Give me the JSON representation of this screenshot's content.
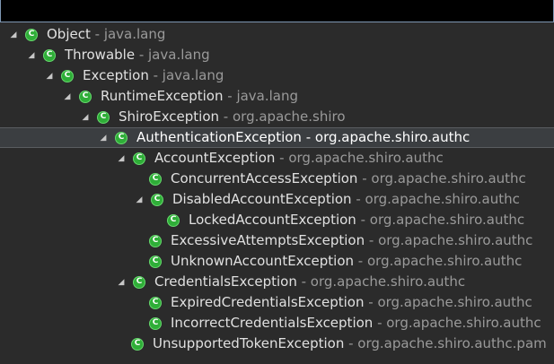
{
  "hierarchy": {
    "separator": " - ",
    "nodes": [
      {
        "name": "Object",
        "package": "java.lang",
        "expanded": true
      },
      {
        "name": "Throwable",
        "package": "java.lang",
        "expanded": true
      },
      {
        "name": "Exception",
        "package": "java.lang",
        "expanded": true
      },
      {
        "name": "RuntimeException",
        "package": "java.lang",
        "expanded": true
      },
      {
        "name": "ShiroException",
        "package": "org.apache.shiro",
        "expanded": true
      },
      {
        "name": "AuthenticationException",
        "package": "org.apache.shiro.authc",
        "expanded": true,
        "selected": true
      },
      {
        "name": "AccountException",
        "package": "org.apache.shiro.authc",
        "expanded": true
      },
      {
        "name": "ConcurrentAccessException",
        "package": "org.apache.shiro.authc",
        "expanded": null
      },
      {
        "name": "DisabledAccountException",
        "package": "org.apache.shiro.authc",
        "expanded": true
      },
      {
        "name": "LockedAccountException",
        "package": "org.apache.shiro.authc",
        "expanded": null
      },
      {
        "name": "ExcessiveAttemptsException",
        "package": "org.apache.shiro.authc",
        "expanded": null
      },
      {
        "name": "UnknownAccountException",
        "package": "org.apache.shiro.authc",
        "expanded": null
      },
      {
        "name": "CredentialsException",
        "package": "org.apache.shiro.authc",
        "expanded": true
      },
      {
        "name": "ExpiredCredentialsException",
        "package": "org.apache.shiro.authc",
        "expanded": null
      },
      {
        "name": "IncorrectCredentialsException",
        "package": "org.apache.shiro.authc",
        "expanded": null
      },
      {
        "name": "UnsupportedTokenException",
        "package": "org.apache.shiro.authc.pam",
        "expanded": null
      }
    ]
  },
  "icons": {
    "class_icon": "class-c-icon",
    "class_letter": "C",
    "expand_arrow": "expanded-arrow-icon"
  },
  "colors": {
    "class_icon_fill": "#2fae38",
    "background": "#2b2b2b",
    "selection": "#3b3e41"
  }
}
